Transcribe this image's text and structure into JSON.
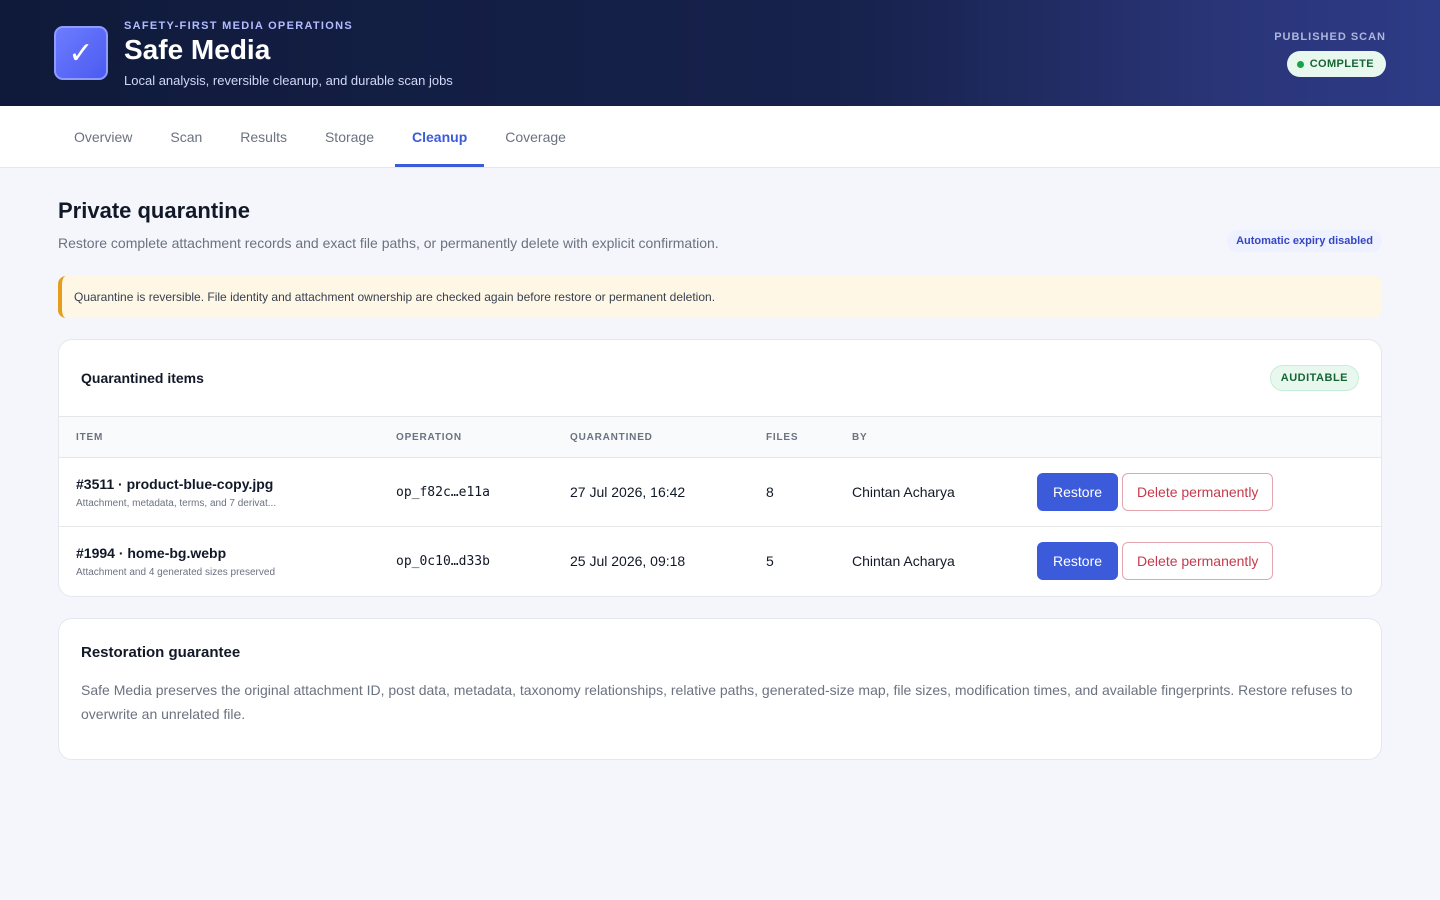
{
  "header": {
    "eyebrow": "SAFETY-FIRST MEDIA OPERATIONS",
    "title": "Safe Media",
    "subtitle": "Local analysis, reversible cleanup, and durable scan jobs",
    "logo_icon": "checkmark-icon",
    "logo_glyph": "✓",
    "scan_label": "PUBLISHED SCAN",
    "scan_status": "COMPLETE"
  },
  "tabs": [
    {
      "label": "Overview",
      "active": false
    },
    {
      "label": "Scan",
      "active": false
    },
    {
      "label": "Results",
      "active": false
    },
    {
      "label": "Storage",
      "active": false
    },
    {
      "label": "Cleanup",
      "active": true
    },
    {
      "label": "Coverage",
      "active": false
    }
  ],
  "page": {
    "title": "Private quarantine",
    "description": "Restore complete attachment records and exact file paths, or permanently delete with explicit confirmation.",
    "expiry_badge": "Automatic expiry disabled",
    "notice": "Quarantine is reversible. File identity and attachment ownership are checked again before restore or permanent deletion."
  },
  "quarantine": {
    "title": "Quarantined items",
    "badge": "AUDITABLE",
    "columns": [
      "ITEM",
      "OPERATION",
      "QUARANTINED",
      "FILES",
      "BY"
    ],
    "rows": [
      {
        "item": "#3511 · product-blue-copy.jpg",
        "detail": "Attachment, metadata, terms, and 7 derivat...",
        "operation": "op_f82c…e11a",
        "quarantined": "27 Jul 2026, 16:42",
        "files": "8",
        "by": "Chintan Acharya"
      },
      {
        "item": "#1994 · home-bg.webp",
        "detail": "Attachment and 4 generated sizes preserved",
        "operation": "op_0c10…d33b",
        "quarantined": "25 Jul 2026, 09:18",
        "files": "5",
        "by": "Chintan Acharya"
      }
    ],
    "restore_label": "Restore",
    "delete_label": "Delete permanently"
  },
  "guarantee": {
    "title": "Restoration guarantee",
    "text": "Safe Media preserves the original attachment ID, post data, metadata, taxonomy relationships, relative paths, generated-size map, file sizes, modification times, and available fingerprints. Restore refuses to overwrite an unrelated file."
  },
  "colors": {
    "accent": "#3b5bdb",
    "header_bg": "#0f1a3a",
    "success": "#16a34a",
    "danger": "#c53a4b",
    "warning": "#e59d1b"
  }
}
